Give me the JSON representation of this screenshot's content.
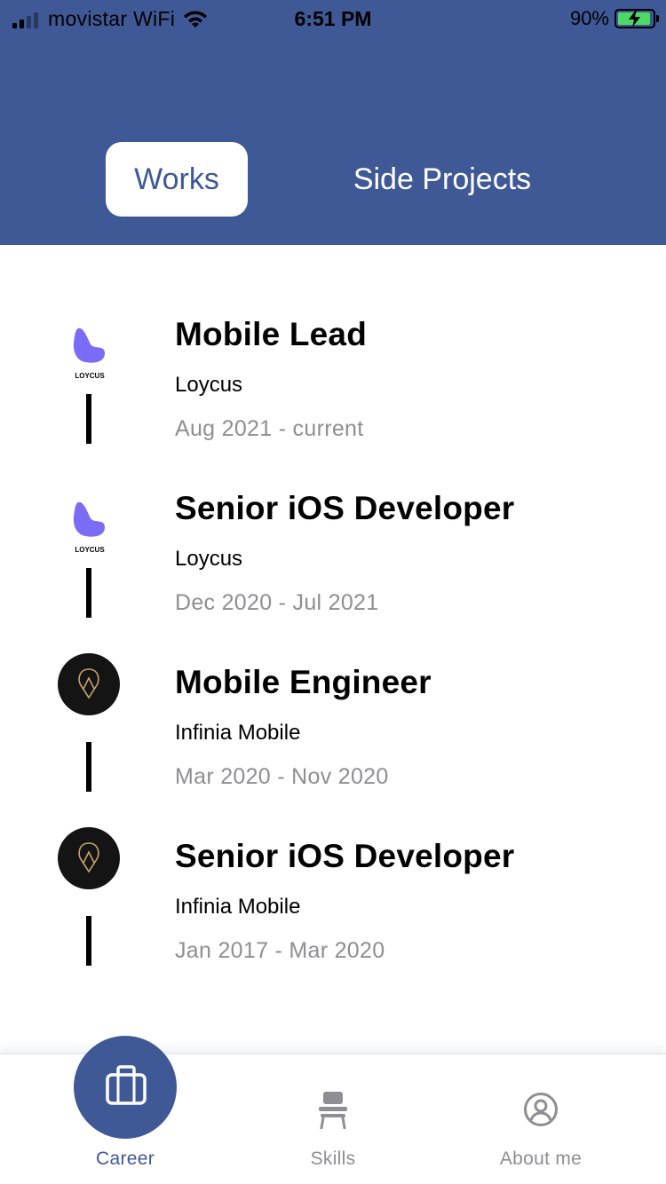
{
  "status_bar": {
    "carrier": "movistar WiFi",
    "time": "6:51 PM",
    "battery": "90%"
  },
  "segments": {
    "works": "Works",
    "side_projects": "Side Projects"
  },
  "jobs": [
    {
      "title": "Mobile Lead",
      "company": "Loycus",
      "period": "Aug 2021 - current",
      "logo": "loycus-logo",
      "logo_text": "LOYCUS"
    },
    {
      "title": "Senior iOS Developer",
      "company": "Loycus",
      "period": "Dec 2020 - Jul 2021",
      "logo": "loycus-logo",
      "logo_text": "LOYCUS"
    },
    {
      "title": "Mobile Engineer",
      "company": "Infinia Mobile",
      "period": "Mar 2020 - Nov 2020",
      "logo": "infinia-logo"
    },
    {
      "title": "Senior iOS Developer",
      "company": "Infinia Mobile",
      "period": "Jan 2017 - Mar 2020",
      "logo": "infinia-logo"
    }
  ],
  "tabbar": {
    "career": "Career",
    "skills": "Skills",
    "about": "About me"
  },
  "colors": {
    "primary": "#3f5896",
    "loycus": "#7b6cf6",
    "infinia_bg": "#141414",
    "infinia_accent": "#c8a56a",
    "muted": "#8e8e93"
  }
}
